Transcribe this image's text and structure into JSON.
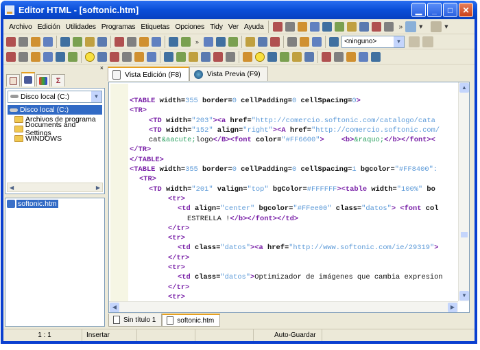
{
  "title": "Editor HTML - [softonic.htm]",
  "menu": [
    "Archivo",
    "Edición",
    "Utilidades",
    "Programas",
    "Etiquetas",
    "Opciones",
    "Tidy",
    "Ver",
    "Ayuda"
  ],
  "toolbar1_icons": [
    "table-wizard-icon",
    "eyedropper-icon",
    "pipette-icon",
    "tag-insert-icon",
    "image-insert-icon",
    "form-icon",
    "brush-icon",
    "pen-icon",
    "bulb-icon",
    "code-tags-icon"
  ],
  "toolbar2_icons": [
    "new-file-icon",
    "new-template-icon",
    "open-file-icon",
    "open-folder-icon",
    "save-disabled-icon",
    "save-icon",
    "save-all-icon",
    "upload-icon",
    "download-icon",
    "clipboard-icon",
    "print-icon",
    "print-preview-icon",
    "printer-icon",
    "notes-icon"
  ],
  "toolbar2b_icons": [
    "frame-icon",
    "person-icon",
    "color-picker-icon",
    "search-doc-icon",
    "page-icon",
    "page-edit-icon",
    "page-list-icon",
    "lock-icon",
    "globe-icon",
    "computer-icon"
  ],
  "style_combo": "<ninguno>",
  "toolbar3_icons": [
    "paragraph-icon",
    "heading-icon",
    "bold-icon",
    "list-icon",
    "comment-icon",
    "check-icon",
    "smiley-icon",
    "undo-icon",
    "redo-icon",
    "cut-icon",
    "copy-icon",
    "paste-icon",
    "eraser-icon",
    "rectangle-icon",
    "find-icon",
    "replace-icon",
    "find-next-icon",
    "indent-icon",
    "outdent-icon",
    "clock-icon",
    "font-color-icon",
    "highlight-icon",
    "strike-icon",
    "book-icon",
    "help-icon",
    "home-icon",
    "mail-icon",
    "users-icon",
    "info-icon"
  ],
  "left": {
    "drive": "Disco local (C:)",
    "tree_root": "Disco local (C:)",
    "folders": [
      "Archivos de programa",
      "Documents and Settings",
      "WINDOWS"
    ],
    "file": "softonic.htm"
  },
  "editor_tabs": [
    "Vista Edición (F8)",
    "Vista Previa (F9)"
  ],
  "doc_tabs": [
    "Sin título 1",
    "softonic.htm"
  ],
  "status": [
    "1 : 1",
    "Insertar",
    "",
    "",
    "Auto-Guardar",
    ""
  ],
  "code": [
    [
      [
        0,
        "tg",
        "<TABLE"
      ],
      [
        "at",
        " width="
      ],
      [
        "vl",
        "355"
      ],
      [
        "at",
        " border="
      ],
      [
        "vl",
        "0"
      ],
      [
        "at",
        " cellPadding="
      ],
      [
        "vl",
        "0"
      ],
      [
        "at",
        " cellSpacing="
      ],
      [
        "vl",
        "0"
      ],
      [
        "tg",
        ">"
      ]
    ],
    [
      [
        0,
        "tg",
        "<TR>"
      ]
    ],
    [
      [
        2,
        "tg",
        "<TD"
      ],
      [
        "at",
        " width="
      ],
      [
        "vl",
        "\"203\""
      ],
      [
        "tg",
        ">"
      ],
      [
        "tg",
        "<a"
      ],
      [
        "at",
        " href="
      ],
      [
        "vl",
        "\"http://comercio.softonic.com/catalogo/cata"
      ]
    ],
    [
      [
        2,
        "tg",
        "<TD"
      ],
      [
        "at",
        " width="
      ],
      [
        "vl",
        "\"152\""
      ],
      [
        "at",
        " align="
      ],
      [
        "vl",
        "\"right\""
      ],
      [
        "tg",
        ">"
      ],
      [
        "tg",
        "<A"
      ],
      [
        "at",
        " href="
      ],
      [
        "vl",
        "\"http://comercio.softonic.com/"
      ]
    ],
    [
      [
        2,
        "tx",
        "cat"
      ],
      [
        "en",
        "&aacute;"
      ],
      [
        "tx",
        "logo"
      ],
      [
        "tg",
        "</B>"
      ],
      [
        "tg",
        "<font"
      ],
      [
        "at",
        " color="
      ],
      [
        "vl",
        "\"#FF6600\""
      ],
      [
        "tg",
        ">"
      ],
      [
        "tx",
        "    "
      ],
      [
        "tg",
        "<b>"
      ],
      [
        "en",
        "&raquo;"
      ],
      [
        "tg",
        "</b></font><"
      ]
    ],
    [
      [
        0,
        "tg",
        "</TR>"
      ]
    ],
    [
      [
        0,
        "tg",
        "</TABLE>"
      ]
    ],
    [
      [
        0,
        "tg",
        "<TABLE"
      ],
      [
        "at",
        " width="
      ],
      [
        "vl",
        "355"
      ],
      [
        "at",
        " border="
      ],
      [
        "vl",
        "0"
      ],
      [
        "at",
        " cellPadding="
      ],
      [
        "vl",
        "0"
      ],
      [
        "at",
        " cellSpacing="
      ],
      [
        "vl",
        "1"
      ],
      [
        "at",
        " bgcolor="
      ],
      [
        "vl",
        "\"#FF8400\":"
      ]
    ],
    [
      [
        1,
        "tg",
        "<TR>"
      ]
    ],
    [
      [
        2,
        "tg",
        "<TD"
      ],
      [
        "at",
        " width="
      ],
      [
        "vl",
        "\"201\""
      ],
      [
        "at",
        " valign="
      ],
      [
        "vl",
        "\"top\""
      ],
      [
        "at",
        " bgColor="
      ],
      [
        "vl",
        "#FFFFFF"
      ],
      [
        "tg",
        ">"
      ],
      [
        "tg",
        "<table"
      ],
      [
        "at",
        " width="
      ],
      [
        "vl",
        "\"100%\""
      ],
      [
        "at",
        " bo"
      ]
    ],
    [
      [
        4,
        "tg",
        "<tr>"
      ]
    ],
    [
      [
        5,
        "tg",
        "<td"
      ],
      [
        "at",
        " align="
      ],
      [
        "vl",
        "\"center\""
      ],
      [
        "at",
        " bgcolor="
      ],
      [
        "vl",
        "\"#FFee00\""
      ],
      [
        "at",
        " class="
      ],
      [
        "vl",
        "\"datos\""
      ],
      [
        "tg",
        ">"
      ],
      [
        "tx",
        " "
      ],
      [
        "tg",
        "<font"
      ],
      [
        "at",
        " col"
      ]
    ],
    [
      [
        6,
        "tx",
        "ESTRELLA !"
      ],
      [
        "tg",
        "</b></font></td>"
      ]
    ],
    [
      [
        4,
        "tg",
        "</tr>"
      ]
    ],
    [
      [
        4,
        "tg",
        "<tr>"
      ]
    ],
    [
      [
        5,
        "tg",
        "<td"
      ],
      [
        "at",
        " class="
      ],
      [
        "vl",
        "\"datos\""
      ],
      [
        "tg",
        ">"
      ],
      [
        "tg",
        "<a"
      ],
      [
        "at",
        " href="
      ],
      [
        "vl",
        "\"http://www.softonic.com/ie/29319\""
      ],
      [
        "tg",
        ">"
      ]
    ],
    [
      [
        4,
        "tg",
        "</tr>"
      ]
    ],
    [
      [
        4,
        "tg",
        "<tr>"
      ]
    ],
    [
      [
        5,
        "tg",
        "<td"
      ],
      [
        "at",
        " class="
      ],
      [
        "vl",
        "\"datos\""
      ],
      [
        "tg",
        ">"
      ],
      [
        "tx",
        "Optimizador de imágenes que cambia expresion"
      ]
    ],
    [
      [
        4,
        "tg",
        "</tr>"
      ]
    ],
    [
      [
        4,
        "tg",
        "<tr>"
      ]
    ]
  ]
}
